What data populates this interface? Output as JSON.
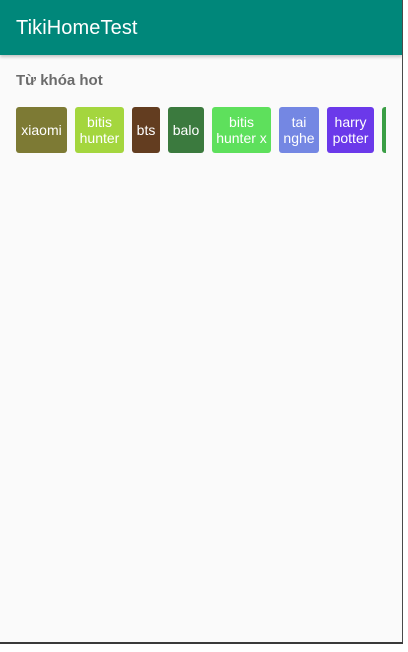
{
  "app_bar": {
    "title": "TikiHomeTest",
    "color": "#00877a"
  },
  "hot_keywords": {
    "title": "Từ khóa hot",
    "items": [
      {
        "label": "xiaomi",
        "color": "#7d7a34"
      },
      {
        "label": "bitis hunter",
        "color": "#a4d63e"
      },
      {
        "label": "bts",
        "color": "#633d20"
      },
      {
        "label": "balo",
        "color": "#3b7a3e"
      },
      {
        "label": "bitis hunter x",
        "color": "#5ee05c"
      },
      {
        "label": "tai nghe",
        "color": "#7487e3"
      },
      {
        "label": "harry potter",
        "color": "#6b39ea"
      },
      {
        "label": "",
        "color": "#3a9e45"
      }
    ]
  }
}
